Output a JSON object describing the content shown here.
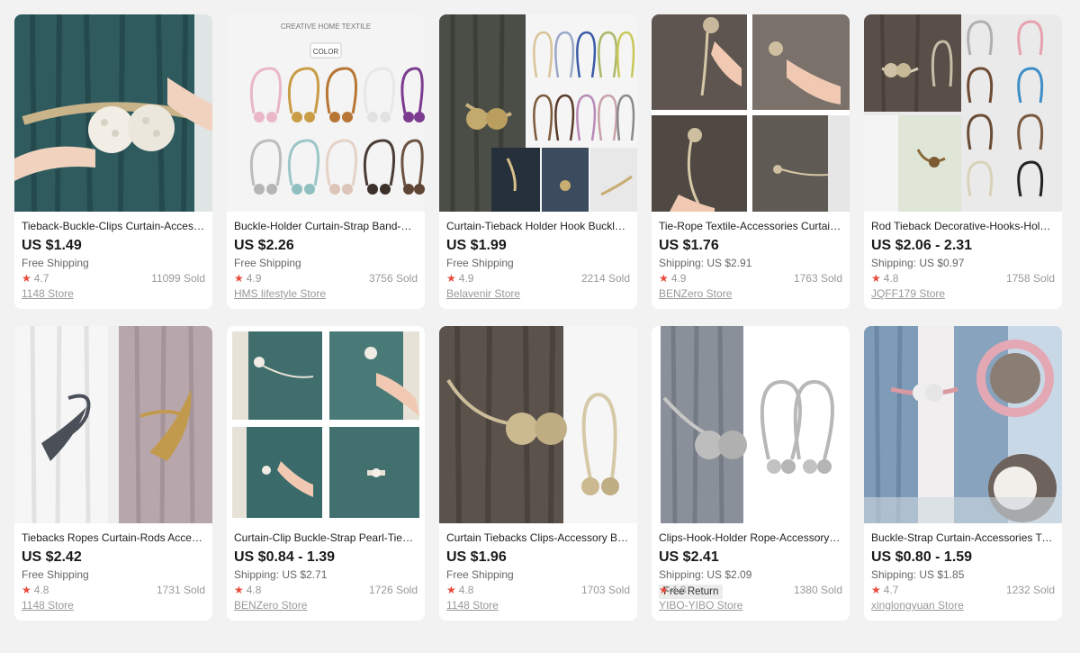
{
  "products": [
    {
      "title": "Tieback-Buckle-Clips Curtain-Accessories",
      "price": "US $1.49",
      "shipping": "Free Shipping",
      "badge": "",
      "rating": "4.7",
      "sold": "11099 Sold",
      "store": "1148 Store"
    },
    {
      "title": "Buckle-Holder Curtain-Strap Band-Tieback",
      "price": "US $2.26",
      "shipping": "Free Shipping",
      "badge": "",
      "rating": "4.9",
      "sold": "3756 Sold",
      "store": "HMS lifestyle Store"
    },
    {
      "title": "Curtain-Tieback Holder Hook Buckle-Clips",
      "price": "US $1.99",
      "shipping": "Free Shipping",
      "badge": "",
      "rating": "4.9",
      "sold": "2214 Sold",
      "store": "Belavenir Store"
    },
    {
      "title": "Tie-Rope Textile-Accessories Curtain-Tieback",
      "price": "US $1.76",
      "shipping": "Shipping: US $2.91",
      "badge": "",
      "rating": "4.9",
      "sold": "1763 Sold",
      "store": "BENZero Store"
    },
    {
      "title": "Rod Tieback Decorative-Hooks-Holder",
      "price": "US $2.06 - 2.31",
      "shipping": "Shipping: US $0.97",
      "badge": "",
      "rating": "4.8",
      "sold": "1758 Sold",
      "store": "JQFF179 Store"
    },
    {
      "title": "Tiebacks Ropes Curtain-Rods Accessories",
      "price": "US $2.42",
      "shipping": "Free Shipping",
      "badge": "",
      "rating": "4.8",
      "sold": "1731 Sold",
      "store": "1148 Store"
    },
    {
      "title": "Curtain-Clip Buckle-Strap Pearl-Tieback",
      "price": "US $0.84 - 1.39",
      "shipping": "Shipping: US $2.71",
      "badge": "",
      "rating": "4.8",
      "sold": "1726 Sold",
      "store": "BENZero Store"
    },
    {
      "title": "Curtain Tiebacks Clips-Accessory Buckle",
      "price": "US $1.96",
      "shipping": "Free Shipping",
      "badge": "",
      "rating": "4.8",
      "sold": "1703 Sold",
      "store": "1148 Store"
    },
    {
      "title": "Clips-Hook-Holder Rope-Accessory-Tieback",
      "price": "US $2.41",
      "shipping": "Shipping: US $2.09",
      "badge": "Free Return",
      "rating": "4.8",
      "sold": "1380 Sold",
      "store": "YIBO-YIBO Store"
    },
    {
      "title": "Buckle-Strap Curtain-Accessories Tieback",
      "price": "US $0.80 - 1.59",
      "shipping": "Shipping: US $1.85",
      "badge": "",
      "rating": "4.7",
      "sold": "1232 Sold",
      "store": "xinglongyuan Store"
    }
  ],
  "image_texts": {
    "p2_header": "CREATIVE HOME TEXTILE",
    "p2_color": "COLOR"
  },
  "icons": {
    "rating": "star-icon"
  },
  "colors": {
    "star": "#e84b3c",
    "price": "#191919",
    "meta": "#999999",
    "background": "#f2f2f2"
  }
}
